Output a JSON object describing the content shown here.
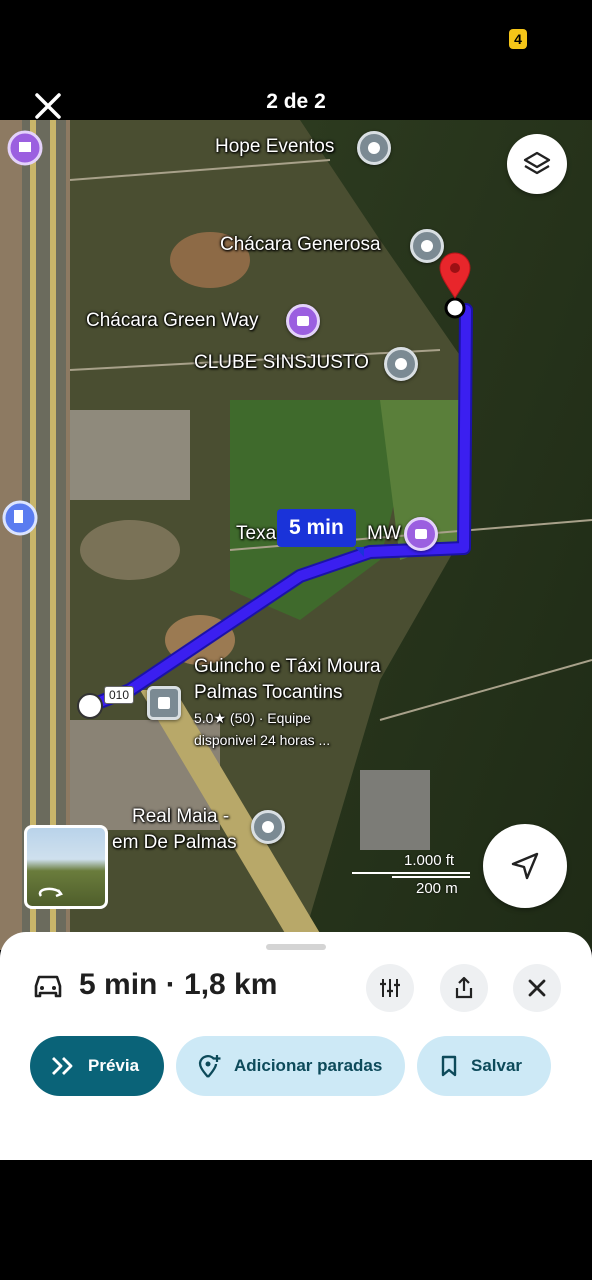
{
  "header": {
    "page_indicator": "2 de 2",
    "status_badge": "4"
  },
  "map": {
    "route_time_label": "5 min",
    "road_shield": "010",
    "places": [
      {
        "name": "Hope Eventos"
      },
      {
        "name": "Chácara Generosa"
      },
      {
        "name": "Chácara Green Way"
      },
      {
        "name": "CLUBE SINSJUSTO"
      },
      {
        "name": "Texa",
        "name_tail": "MW"
      },
      {
        "name": "Guincho e Táxi Moura",
        "name_line2": "Palmas Tocantins",
        "rating": "5.0★ (50) · Equipe",
        "detail": "disponivel 24 horas ..."
      },
      {
        "name": "Real Maia -",
        "name_line2": "em De Palmas"
      }
    ],
    "scale": {
      "feet": "1.000 ft",
      "meters": "200 m"
    }
  },
  "sheet": {
    "summary": "5 min · 1,8 km",
    "preview_label": "Prévia",
    "add_stops_label": "Adicionar paradas",
    "save_label": "Salvar"
  },
  "colors": {
    "route": "#3b1ff0",
    "destination_pin": "#e8262b",
    "primary_button": "#0a6378",
    "secondary_button": "#cde9f6"
  },
  "icons": [
    "close-icon",
    "layers-icon",
    "navigation-arrow-icon",
    "car-icon",
    "route-options-icon",
    "share-icon",
    "close-icon",
    "double-chevron-icon",
    "add-location-icon",
    "bookmark-icon",
    "gas-station-icon",
    "destination-pin-icon"
  ]
}
